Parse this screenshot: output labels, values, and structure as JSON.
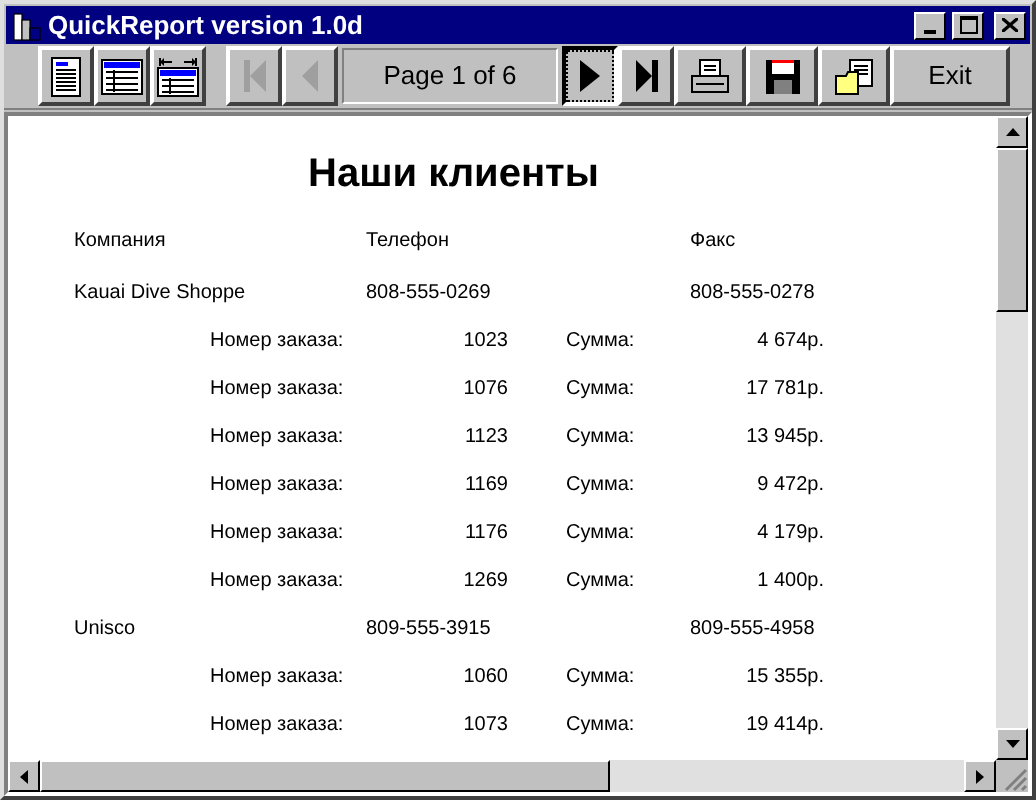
{
  "window": {
    "title": "QuickReport version 1.0d"
  },
  "toolbar": [
    {
      "kind": "zoom-page",
      "disabled": false,
      "selected": false
    },
    {
      "kind": "zoom-100",
      "disabled": false,
      "selected": false
    },
    {
      "kind": "zoom-width",
      "disabled": false,
      "selected": false
    },
    {
      "kind": "first",
      "disabled": true,
      "selected": false
    },
    {
      "kind": "prev",
      "disabled": true,
      "selected": false
    },
    {
      "kind": "page-label",
      "label": "Page 1 of 6"
    },
    {
      "kind": "next",
      "disabled": false,
      "selected": true
    },
    {
      "kind": "last",
      "disabled": false,
      "selected": false
    },
    {
      "kind": "print",
      "disabled": false,
      "selected": false
    },
    {
      "kind": "save",
      "disabled": false,
      "selected": false
    },
    {
      "kind": "open",
      "disabled": false,
      "selected": false
    },
    {
      "kind": "exit",
      "label": "Exit",
      "disabled": false,
      "selected": false
    }
  ],
  "report": {
    "title": "Наши клиенты",
    "columns": [
      "Компания",
      "Телефон",
      "Факс"
    ],
    "customers": [
      {
        "company": "Kauai Dive Shoppe",
        "phone": "808-555-0269",
        "fax": "808-555-0278",
        "orders": [
          {
            "order_label": "Номер заказа:",
            "number": "1023",
            "sum_label": "Сумма:",
            "sum": "4 674р."
          },
          {
            "order_label": "Номер заказа:",
            "number": "1076",
            "sum_label": "Сумма:",
            "sum": "17 781р."
          },
          {
            "order_label": "Номер заказа:",
            "number": "1123",
            "sum_label": "Сумма:",
            "sum": "13 945р."
          },
          {
            "order_label": "Номер заказа:",
            "number": "1169",
            "sum_label": "Сумма:",
            "sum": "9 472р."
          },
          {
            "order_label": "Номер заказа:",
            "number": "1176",
            "sum_label": "Сумма:",
            "sum": "4 179р."
          },
          {
            "order_label": "Номер заказа:",
            "number": "1269",
            "sum_label": "Сумма:",
            "sum": "1 400р."
          }
        ]
      },
      {
        "company": "Unisco",
        "phone": "809-555-3915",
        "fax": "809-555-4958",
        "orders": [
          {
            "order_label": "Номер заказа:",
            "number": "1060",
            "sum_label": "Сумма:",
            "sum": "15 355р."
          },
          {
            "order_label": "Номер заказа:",
            "number": "1073",
            "sum_label": "Сумма:",
            "sum": "19 414р."
          }
        ]
      }
    ]
  }
}
